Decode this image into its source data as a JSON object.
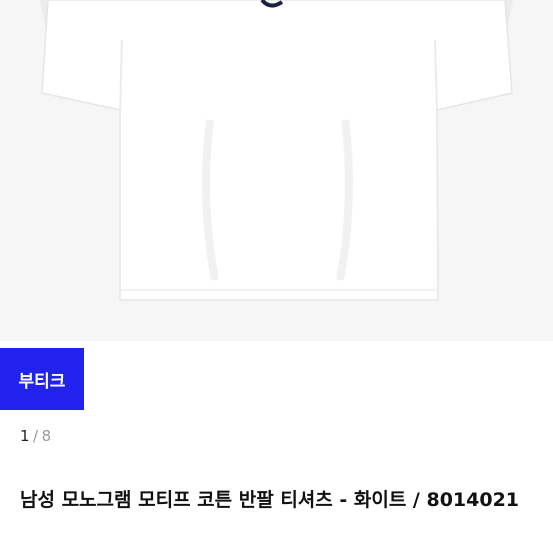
{
  "colors": {
    "badge_bg": "#2222ee",
    "hero_bg": "#f6f6f6",
    "shirt": "#ffffff",
    "shirt_shadow": "#e6e6e6",
    "text_primary": "#111111",
    "text_muted": "#9a9a9a"
  },
  "product_image": {
    "subject": "white short-sleeve t-shirt"
  },
  "badge": {
    "label": "부티크"
  },
  "pager": {
    "current": "1",
    "separator": "/",
    "total": "8"
  },
  "product": {
    "title": "남성 모노그램 모티프 코튼 반팔 티셔츠 - 화이트 / 8014021"
  }
}
